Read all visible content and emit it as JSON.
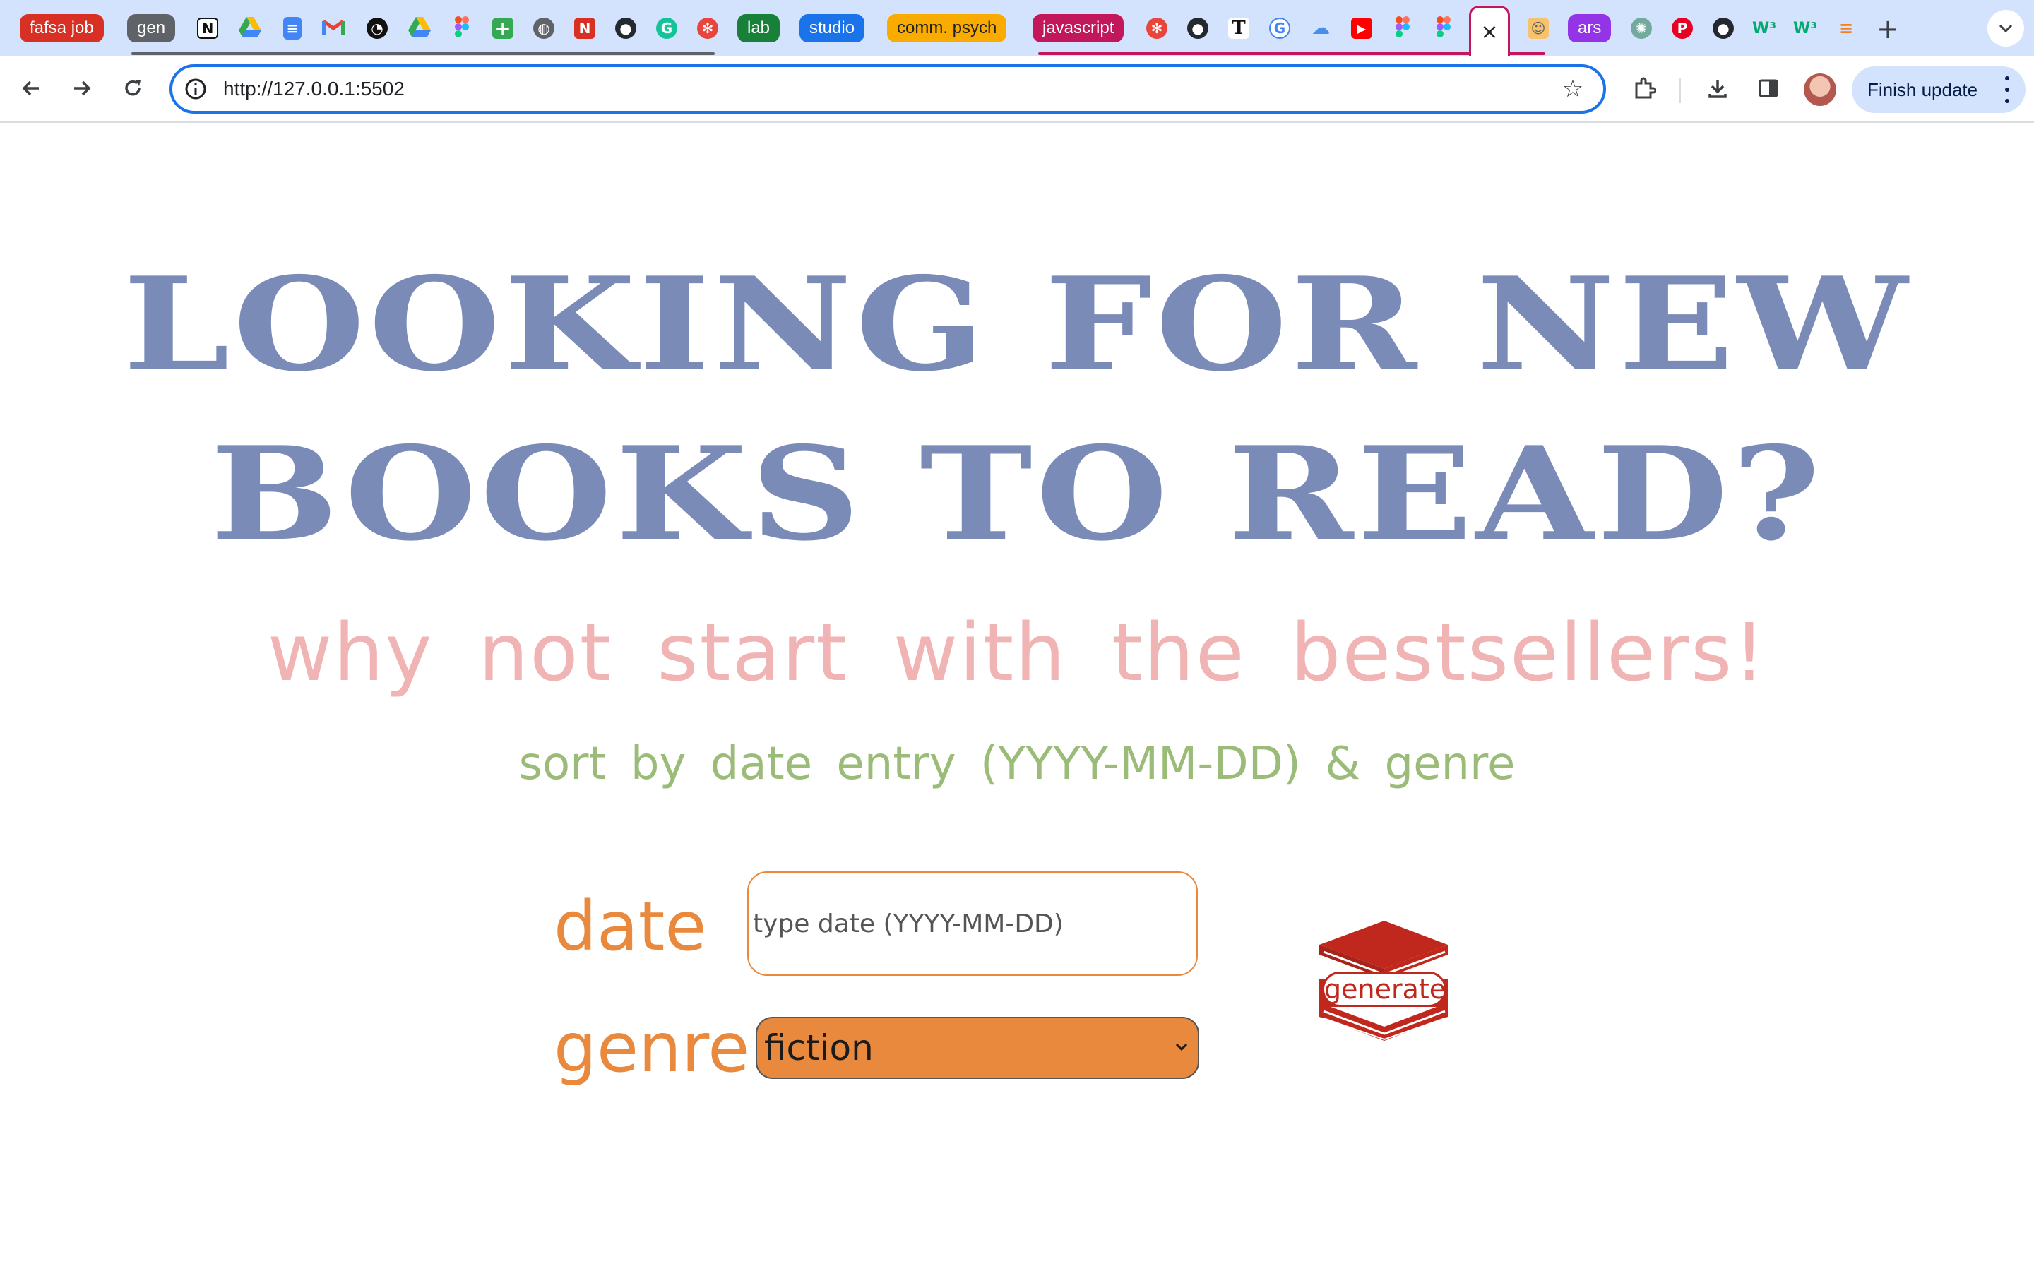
{
  "browser": {
    "tab_groups": [
      {
        "label": "fafsa job",
        "color": "#d93025"
      },
      {
        "label": "gen",
        "color": "#5f6368"
      },
      {
        "label": "lab",
        "color": "#188038"
      },
      {
        "label": "studio",
        "color": "#1a73e8"
      },
      {
        "label": "comm. psych",
        "color": "#f9ab00"
      },
      {
        "label": "javascript",
        "color": "#c2185b"
      },
      {
        "label": "ars",
        "color": "#9334e6"
      }
    ],
    "tab_icons": [
      "notion-icon",
      "google-drive-icon",
      "google-docs-icon",
      "gmail-icon",
      "timer-icon",
      "google-drive-icon",
      "figma-icon",
      "google-sheets-icon",
      "globe-icon",
      "news-icon",
      "github-icon",
      "grammarly-icon",
      "settings-wheel-icon",
      "settings-wheel-icon",
      "github-icon",
      "nytimes-icon",
      "google-icon",
      "cloud-icon",
      "youtube-icon",
      "figma-icon",
      "figma-icon",
      "person-icon",
      "chatgpt-icon",
      "pinterest-icon",
      "github-icon",
      "w3schools-icon",
      "w3schools-icon",
      "stackoverflow-icon"
    ],
    "active_tab_close": "×",
    "new_tab": "+",
    "url": "http://127.0.0.1:5502",
    "finish_update": "Finish update"
  },
  "page": {
    "headline_line1": "LOOKING FOR NEW",
    "headline_line2": "BOOKS TO READ?",
    "subtitle": "why not start with the bestsellers!",
    "instruction": "sort by date entry (YYYY-MM-DD) & genre",
    "date_label": "date",
    "date_placeholder": "type date (YYYY-MM-DD)",
    "date_value": "",
    "genre_label": "genre",
    "genre_selected": "fiction",
    "generate_label": "generate"
  },
  "colors": {
    "headline": "#7b8bb8",
    "subtitle": "#f0b4b4",
    "instruction": "#9bbb78",
    "labels": "#e8893d",
    "select_bg": "#e8893d",
    "generate": "#c0281e",
    "omnibox_border": "#1a73e8",
    "tabstrip": "#d3e3fd"
  }
}
